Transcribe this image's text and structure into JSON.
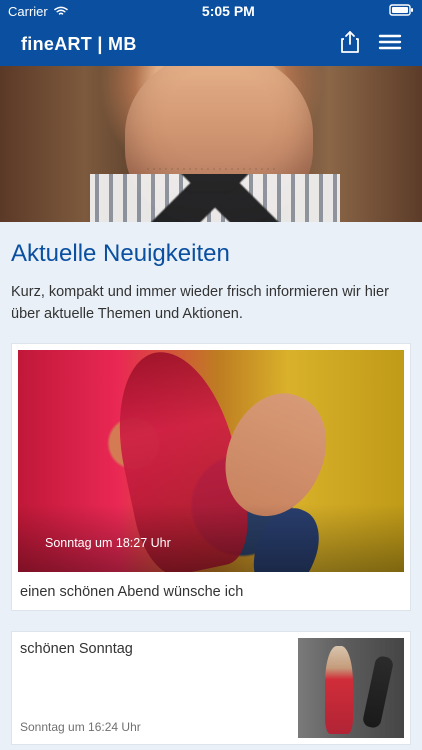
{
  "status_bar": {
    "carrier": "Carrier",
    "time": "5:05 PM",
    "wifi_icon": "wifi-icon",
    "battery_icon": "battery-icon"
  },
  "navbar": {
    "title": "fineART | MB",
    "share_icon": "share-icon",
    "menu_icon": "menu-icon"
  },
  "main": {
    "section_title": "Aktuelle Neuigkeiten",
    "intro": "Kurz, kompakt und immer wieder frisch informieren wir hier über aktuelle Themen und Aktionen.",
    "news_card": {
      "time": "Sonntag um 18:27 Uhr",
      "caption": "einen schönen Abend wünsche ich"
    },
    "small_card": {
      "title": "schönen Sonntag",
      "time": "Sonntag um 16:24 Uhr"
    }
  },
  "colors": {
    "primary": "#0a4fa0",
    "background": "#e9f0f8",
    "card": "#ffffff",
    "text": "#333333",
    "muted_text": "#707070"
  }
}
